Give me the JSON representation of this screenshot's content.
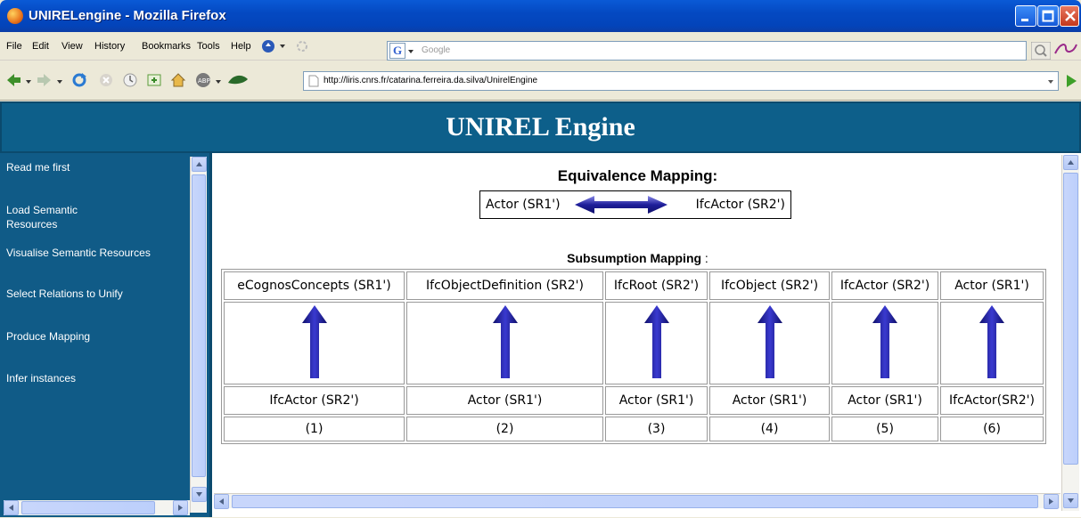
{
  "window": {
    "title": "UNIRELengine - Mozilla Firefox",
    "accent": "#0449c2"
  },
  "menu": [
    "File",
    "Edit",
    "View",
    "History",
    "Bookmarks",
    "Tools",
    "Help"
  ],
  "search": {
    "placeholder": "Google"
  },
  "navbar": {
    "url": "http://liris.cnrs.fr/catarina.ferreira.da.silva/UnirelEngine"
  },
  "page": {
    "title": "UNIREL Engine",
    "header_color": "#0d5f8a"
  },
  "sidebar": {
    "items": [
      {
        "label": "Read me first"
      },
      {
        "label": "Load Semantic Resources"
      },
      {
        "label": "Visualise Semantic Resources"
      },
      {
        "label": "Select Relations to Unify"
      },
      {
        "label": "Produce Mapping"
      },
      {
        "label": "Infer instances"
      }
    ]
  },
  "equivalence": {
    "title": "Equivalence Mapping:",
    "left": "Actor (SR1')",
    "right": "IfcActor (SR2')"
  },
  "subsumption": {
    "title": "Subsumption Mapping",
    "colon": " :",
    "columns": [
      {
        "top": "eCognosConcepts (SR1')",
        "bottom": "IfcActor (SR2')",
        "num": "(1)"
      },
      {
        "top": "IfcObjectDefinition (SR2')",
        "bottom": "Actor (SR1')",
        "num": "(2)"
      },
      {
        "top": "IfcRoot (SR2')",
        "bottom": "Actor (SR1')",
        "num": "(3)"
      },
      {
        "top": "IfcObject (SR2')",
        "bottom": "Actor (SR1')",
        "num": "(4)"
      },
      {
        "top": "IfcActor (SR2')",
        "bottom": "Actor (SR1')",
        "num": "(5)"
      },
      {
        "top": "Actor (SR1')",
        "bottom": "IfcActor(SR2')",
        "num": "(6)"
      }
    ]
  }
}
